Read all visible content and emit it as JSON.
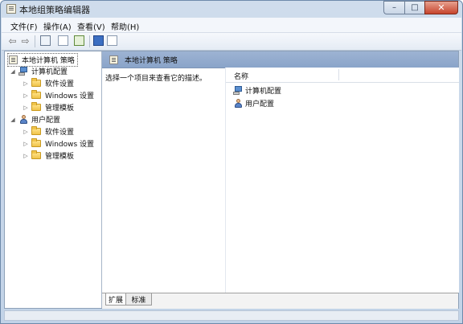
{
  "window": {
    "title": "本地组策略编辑器"
  },
  "caption": {
    "minimize": "–",
    "maximize": "□",
    "close": "✕"
  },
  "menu": [
    "文件(F)",
    "操作(A)",
    "查看(V)",
    "帮助(H)"
  ],
  "toolbar": {
    "icons": [
      "back-arrow-icon",
      "forward-arrow-icon",
      "show-tree-icon",
      "properties-icon",
      "export-list-icon",
      "help-icon",
      "show-action-pane-icon"
    ],
    "back": "⇦",
    "forward": "⇨"
  },
  "tree": {
    "root": "本地计算机 策略",
    "computer": {
      "label": "计算机配置",
      "children": [
        "软件设置",
        "Windows 设置",
        "管理模板"
      ]
    },
    "user": {
      "label": "用户配置",
      "children": [
        "软件设置",
        "Windows 设置",
        "管理模板"
      ]
    }
  },
  "right_pane": {
    "header": "本地计算机 策略",
    "description": "选择一个项目来查看它的描述。",
    "column_name": "名称",
    "items": [
      "计算机配置",
      "用户配置"
    ]
  },
  "tabs": [
    "扩展",
    "标准"
  ]
}
